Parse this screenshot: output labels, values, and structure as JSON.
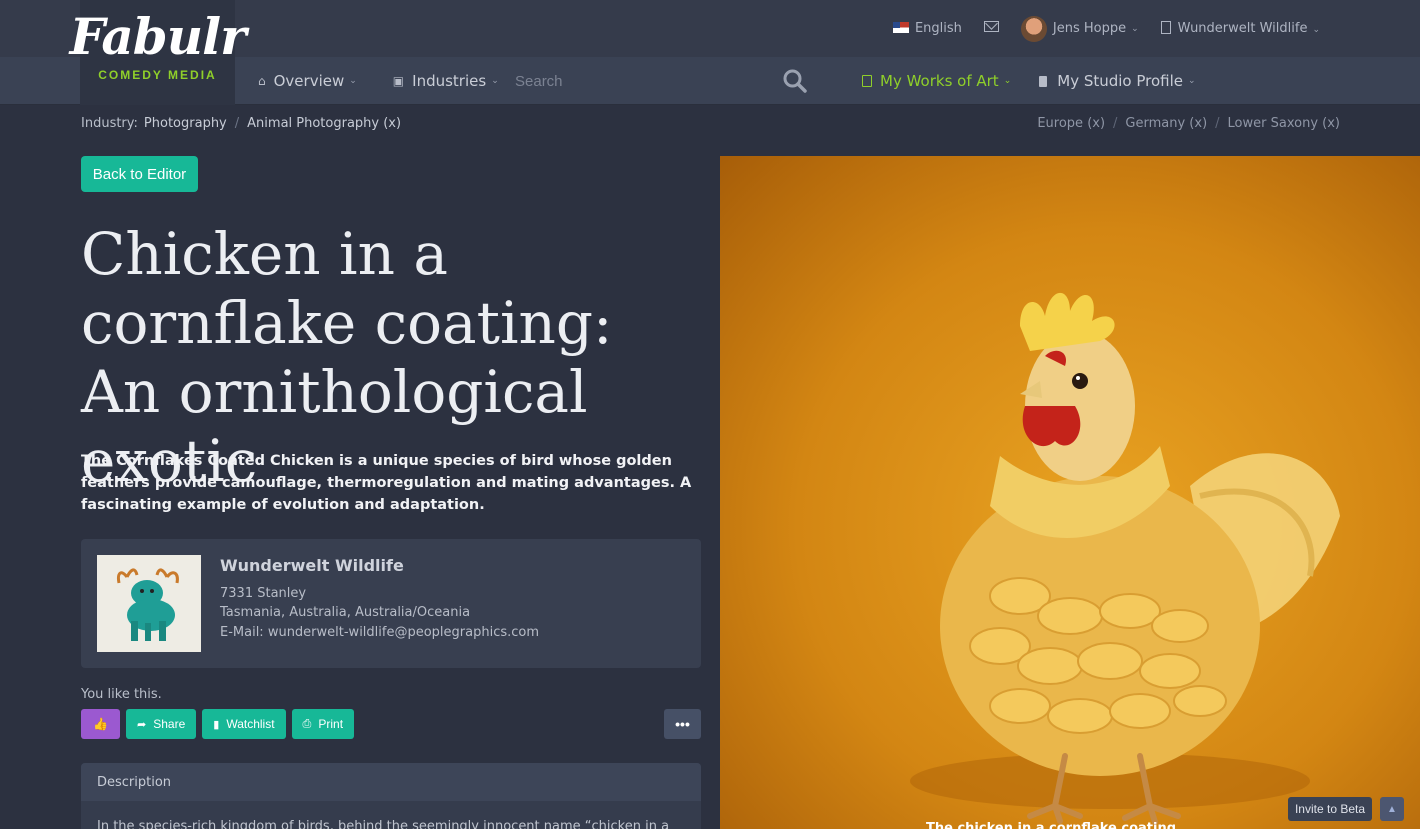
{
  "brand": {
    "logo_word": "Fabulr",
    "logo_sub": "COMEDY MEDIA"
  },
  "topbar": {
    "language": "English",
    "user": "Jens Hoppe",
    "org": "Wunderwelt Wildlife"
  },
  "nav": {
    "overview": "Overview",
    "industries": "Industries",
    "search_placeholder": "Search",
    "works": "My Works of Art",
    "studio": "My Studio Profile"
  },
  "breadcrumb": {
    "label": "Industry:",
    "items": [
      "Photography",
      "Animal Photography (x)"
    ],
    "regions": [
      "Europe (x)",
      "Germany (x)",
      "Lower Saxony (x)"
    ]
  },
  "actions": {
    "back": "Back to Editor",
    "share": "Share",
    "watchlist": "Watchlist",
    "print": "Print",
    "more": "•••"
  },
  "article": {
    "title": "Chicken in a cornflake coating: An ornithological exotic",
    "lead": "The Cornflakes Coated Chicken is a unique species of bird whose golden feathers provide camouflage, thermoregulation and mating advantages. A fascinating example of evolution and adaptation.",
    "liked_text": "You like this.",
    "description_header": "Description",
    "description_preview": "In the species-rich kingdom of birds, behind the seemingly innocent name “chicken in a cornflake",
    "image_caption": "The chicken in a cornflake coating"
  },
  "publisher": {
    "name": "Wunderwelt Wildlife",
    "street": "7331 Stanley",
    "region": "Tasmania, Australia, Australia/Oceania",
    "email": "E-Mail: wunderwelt-wildlife@peoplegraphics.com"
  },
  "footer": {
    "invite": "Invite to Beta",
    "up": "▲"
  },
  "colors": {
    "accent": "#17b897",
    "like": "#9b59d0",
    "works_active": "#8fcf2a",
    "background": "#2c3140"
  }
}
